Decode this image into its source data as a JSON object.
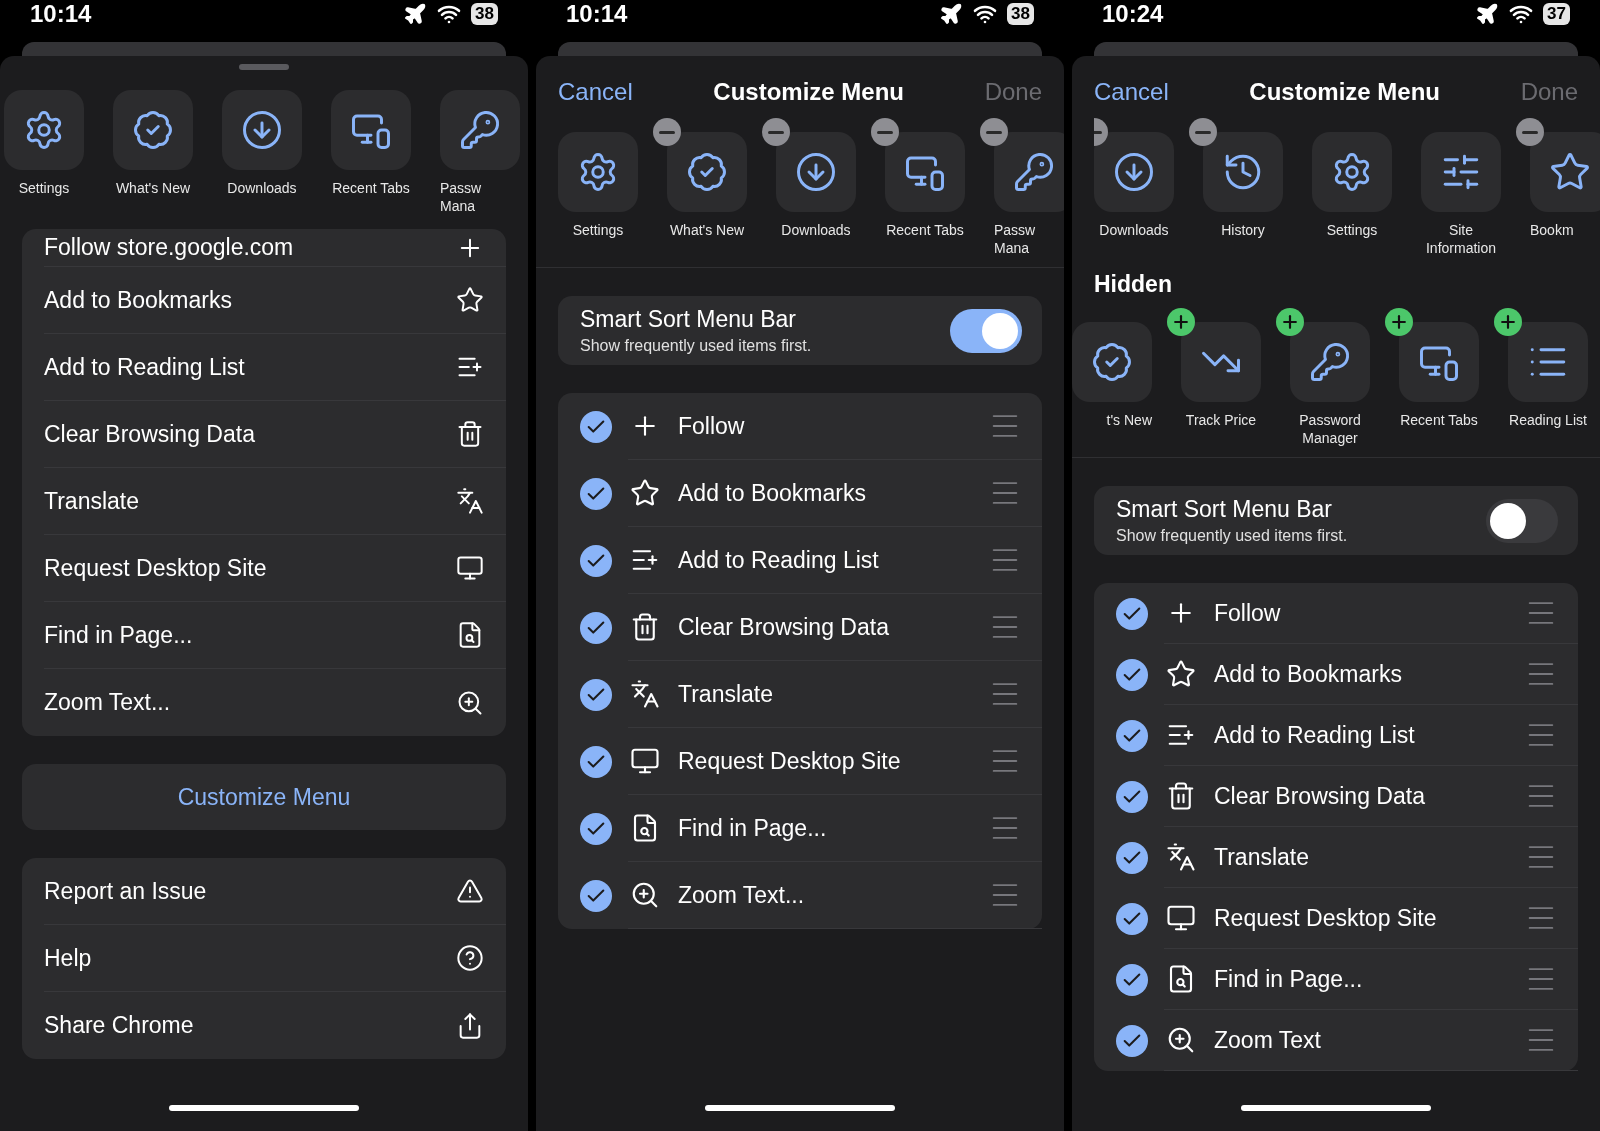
{
  "screens": [
    {
      "kind": "menu",
      "status": {
        "time": "10:14",
        "battery": "38"
      },
      "actions": [
        {
          "label": "Settings",
          "kind": "settings"
        },
        {
          "label": "What's New",
          "kind": "whatsnew"
        },
        {
          "label": "Downloads",
          "kind": "downloads"
        },
        {
          "label": "Recent Tabs",
          "kind": "devices"
        },
        {
          "label": "Passw\nMana",
          "kind": "key"
        }
      ],
      "menu_items": [
        {
          "label": "Follow store.google.com",
          "kind": "plus"
        },
        {
          "label": "Add to Bookmarks",
          "kind": "star"
        },
        {
          "label": "Add to Reading List",
          "kind": "readinglist"
        },
        {
          "label": "Clear Browsing Data",
          "kind": "trash"
        },
        {
          "label": "Translate",
          "kind": "translate"
        },
        {
          "label": "Request Desktop Site",
          "kind": "monitor"
        },
        {
          "label": "Find in Page...",
          "kind": "find"
        },
        {
          "label": "Zoom Text...",
          "kind": "zoom"
        }
      ],
      "customize_button": "Customize Menu",
      "footer_items": [
        {
          "label": "Report an Issue",
          "kind": "warning"
        },
        {
          "label": "Help",
          "kind": "help"
        },
        {
          "label": "Share Chrome",
          "kind": "share"
        }
      ]
    },
    {
      "kind": "customize",
      "status": {
        "time": "10:14",
        "battery": "38"
      },
      "cancel": "Cancel",
      "title": "Customize Menu",
      "done": {
        "label": "Done",
        "disabled": true
      },
      "actions": [
        {
          "label": "Settings",
          "kind": "settings",
          "removable": false
        },
        {
          "label": "What's New",
          "kind": "whatsnew",
          "removable": true
        },
        {
          "label": "Downloads",
          "kind": "downloads",
          "removable": true
        },
        {
          "label": "Recent Tabs",
          "kind": "devices",
          "removable": true
        },
        {
          "label": "Passw\nMana",
          "kind": "key",
          "removable": true
        }
      ],
      "smart_sort": {
        "title": "Smart Sort Menu Bar",
        "subtitle": "Show frequently used items first.",
        "on": true
      },
      "items": [
        {
          "label": "Follow",
          "kind": "plus",
          "checked": true
        },
        {
          "label": "Add to Bookmarks",
          "kind": "star",
          "checked": true
        },
        {
          "label": "Add to Reading List",
          "kind": "readinglist",
          "checked": true
        },
        {
          "label": "Clear Browsing Data",
          "kind": "trash",
          "checked": true
        },
        {
          "label": "Translate",
          "kind": "translate",
          "checked": true
        },
        {
          "label": "Request Desktop Site",
          "kind": "monitor",
          "checked": true
        },
        {
          "label": "Find in Page...",
          "kind": "find",
          "checked": true
        },
        {
          "label": "Zoom Text...",
          "kind": "zoom",
          "checked": true
        }
      ]
    },
    {
      "kind": "customize",
      "status": {
        "time": "10:24",
        "battery": "37"
      },
      "cancel": "Cancel",
      "title": "Customize Menu",
      "done": {
        "label": "Done",
        "disabled": true
      },
      "actions": [
        {
          "label": "Downloads",
          "kind": "downloads",
          "removable": true
        },
        {
          "label": "History",
          "kind": "history",
          "removable": true
        },
        {
          "label": "Settings",
          "kind": "settings",
          "removable": false
        },
        {
          "label": "Site\nInformation",
          "kind": "siteinfo",
          "removable": false
        },
        {
          "label": "Bookm",
          "kind": "star",
          "removable": true
        }
      ],
      "hidden": {
        "title": "Hidden",
        "actions": [
          {
            "label": "t's New",
            "kind": "whatsnew",
            "addable": false
          },
          {
            "label": "Track Price",
            "kind": "trackprice",
            "addable": true
          },
          {
            "label": "Password\nManager",
            "kind": "key",
            "addable": true
          },
          {
            "label": "Recent Tabs",
            "kind": "devices",
            "addable": true
          },
          {
            "label": "Reading List",
            "kind": "list",
            "addable": true
          }
        ]
      },
      "smart_sort": {
        "title": "Smart Sort Menu Bar",
        "subtitle": "Show frequently used items first.",
        "on": false
      },
      "items": [
        {
          "label": "Follow",
          "kind": "plus",
          "checked": true
        },
        {
          "label": "Add to Bookmarks",
          "kind": "star",
          "checked": true
        },
        {
          "label": "Add to Reading List",
          "kind": "readinglist",
          "checked": true
        },
        {
          "label": "Clear Browsing Data",
          "kind": "trash",
          "checked": true
        },
        {
          "label": "Translate",
          "kind": "translate",
          "checked": true
        },
        {
          "label": "Request Desktop Site",
          "kind": "monitor",
          "checked": true
        },
        {
          "label": "Find in Page...",
          "kind": "find",
          "checked": true
        },
        {
          "label": "Zoom Text",
          "kind": "zoom",
          "checked": true
        }
      ]
    }
  ]
}
